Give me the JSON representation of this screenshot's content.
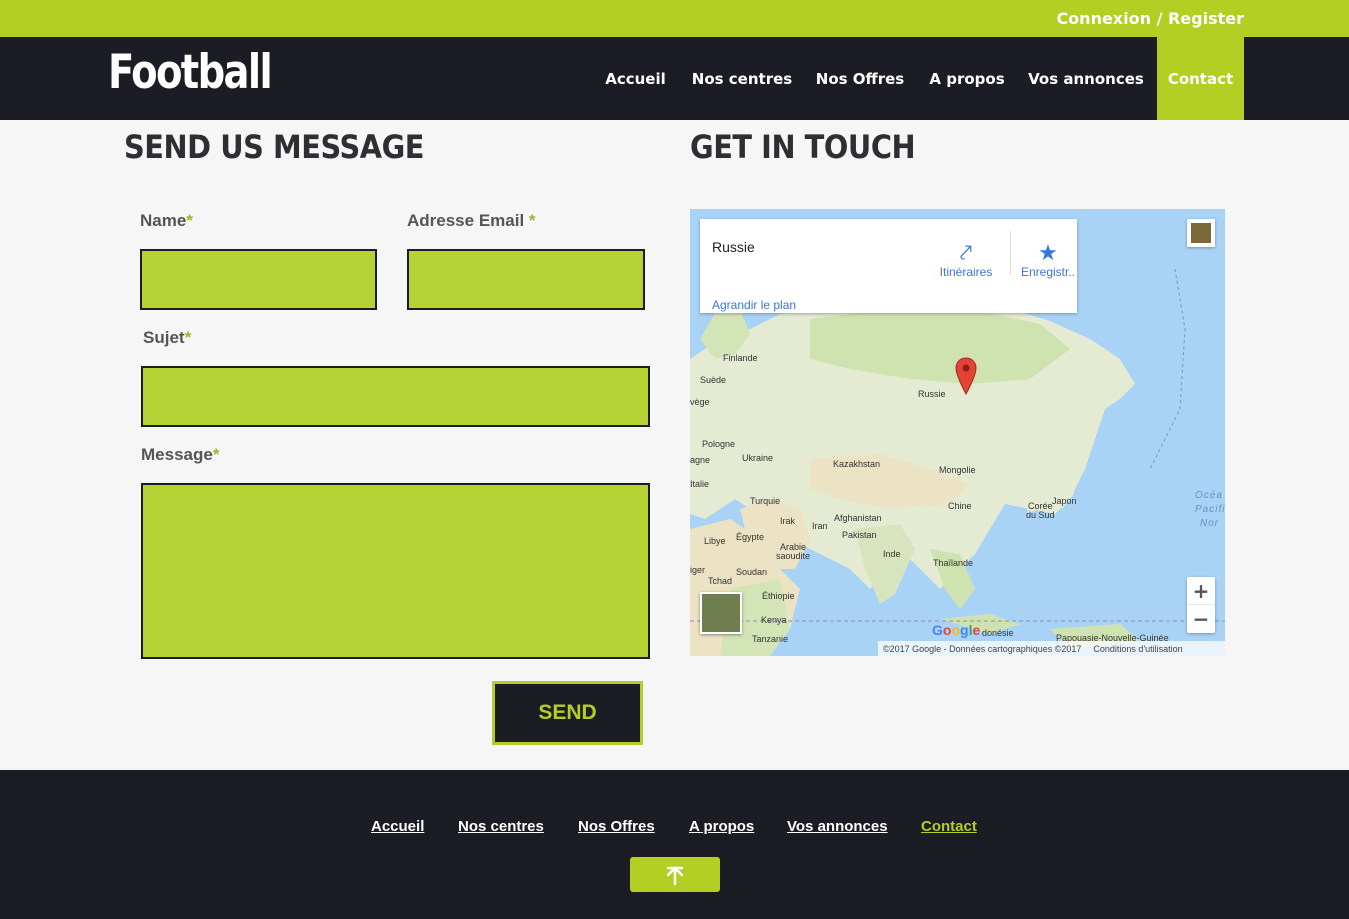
{
  "topbar": {
    "login_label": "Connexion / Register"
  },
  "header": {
    "logo": "Football",
    "nav": [
      {
        "label": "Accueil"
      },
      {
        "label": "Nos centres"
      },
      {
        "label": "Nos Offres"
      },
      {
        "label": "A propos"
      },
      {
        "label": "Vos annonces"
      },
      {
        "label": "Contact",
        "active": true
      }
    ]
  },
  "form": {
    "title": "SEND US MESSAGE",
    "name_label": "Name",
    "email_label": "Adresse Email ",
    "subject_label": "Sujet",
    "message_label": "Message",
    "required_mark": "*",
    "send_label": "SEND"
  },
  "contact": {
    "title": "GET IN TOUCH",
    "map": {
      "place_title": "Russie",
      "directions_label": "Itinéraires",
      "save_label": "Enregistr..",
      "enlarge_label": "Agrandir le plan",
      "zoom_in": "+",
      "zoom_out": "−",
      "attribution": "©2017 Google - Données cartographiques ©2017",
      "terms": "Conditions d'utilisation",
      "labels": {
        "finlande": "Finlande",
        "suede": "Suède",
        "vege": "vège",
        "russie": "Russie",
        "pologne": "Pologne",
        "ukraine": "Ukraine",
        "agne": "agne",
        "kazakhstan": "Kazakhstan",
        "mongolie": "Mongolie",
        "italie": "Italie",
        "turquie": "Turquie",
        "irak": "Irak",
        "iran": "Iran",
        "afghanistan": "Afghanistan",
        "pakistan": "Pakistan",
        "chine": "Chine",
        "coree": "Corée\ndu Sud",
        "japon": "Japon",
        "libye": "Libye",
        "egypte": "Égypte",
        "arabie": "Arabie\nsaoudite",
        "inde": "Inde",
        "thailande": "Thaïlande",
        "iger": "iger",
        "tchad": "Tchad",
        "soudan": "Soudan",
        "ethiopie": "Éthiopie",
        "kenya": "Kenya",
        "tanzanie": "Tanzanie",
        "indonesie": "donésie",
        "papouasie": "Papouasie-Nouvelle-Guinée",
        "ocean1": "Océa",
        "ocean2": "Pacifi",
        "ocean3": "Nor"
      },
      "google_letters": [
        "G",
        "o",
        "o",
        "g",
        "l",
        "e"
      ],
      "colors": {
        "water": "#a8d3f7",
        "land": "#e8eed8",
        "green": "#cfe3b0",
        "desert": "#ece3c4",
        "pin": "#e44235"
      }
    }
  },
  "footer": {
    "nav": [
      {
        "label": "Accueil"
      },
      {
        "label": "Nos centres"
      },
      {
        "label": "Nos Offres"
      },
      {
        "label": "A propos"
      },
      {
        "label": "Vos annonces"
      },
      {
        "label": "Contact",
        "active": true
      }
    ],
    "back_to_top_icon": "arrow-up-icon"
  },
  "colors": {
    "accent": "#b3cf23",
    "dark": "#1c1c24",
    "field": "#b5d334",
    "page_bg": "#f6f6f6"
  }
}
